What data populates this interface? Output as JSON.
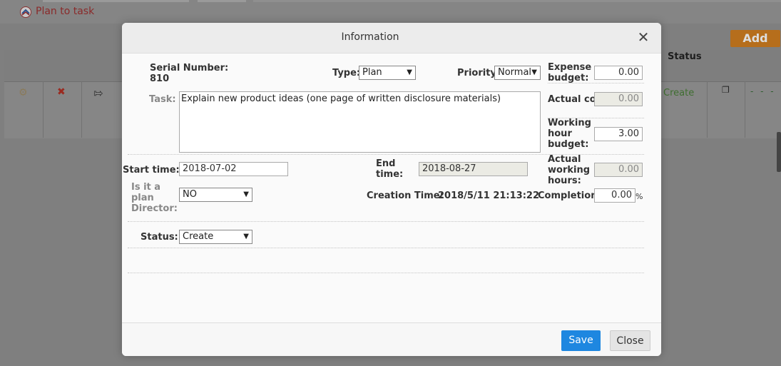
{
  "background": {
    "page_title": "Plan to task",
    "add_button": "Add",
    "grid_status_header": "Status",
    "row_status": "Create",
    "row_dashes": "- - -"
  },
  "dialog": {
    "title": "Information",
    "serial_label": "Serial Number:",
    "serial_value": "810",
    "type_label": "Type:",
    "type_value": "Plan",
    "priority_label": "Priority:",
    "priority_value": "Normal",
    "expense_budget_label": "Expense budget:",
    "expense_budget_value": "0.00",
    "task_label": "Task:",
    "task_value": "Explain new product ideas (one page of written disclosure materials)",
    "actual_cost_label": "Actual cost:",
    "actual_cost_value": "0.00",
    "working_hour_budget_label": "Working hour budget:",
    "working_hour_budget_value": "3.00",
    "start_time_label": "Start time:",
    "start_time_value": "2018-07-02",
    "end_time_label": "End time:",
    "end_time_value": "2018-08-27",
    "actual_working_hours_label": "Actual working hours:",
    "actual_working_hours_value": "0.00",
    "is_plan_director_label": "Is it a plan Director:",
    "is_plan_director_value": "NO",
    "creation_time_label": "Creation Time:",
    "creation_time_value": "2018/5/11 21:13:22",
    "completion_label": "Completion:",
    "completion_value": "0.00",
    "completion_unit": "%",
    "status_label": "Status:",
    "status_value": "Create",
    "save_button": "Save",
    "close_button": "Close"
  }
}
